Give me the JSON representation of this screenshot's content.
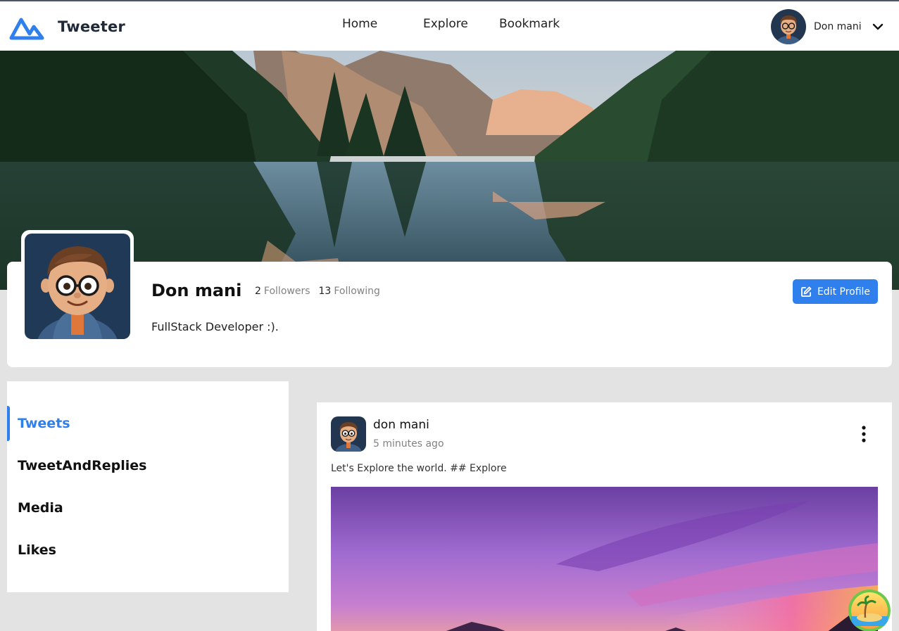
{
  "app": {
    "brand_name": "Tweeter",
    "brand_icon": "mountain-logo-icon",
    "accent_color": "#2f80ed"
  },
  "nav": {
    "links": [
      "Home",
      "Explore",
      "Bookmark"
    ]
  },
  "user_menu": {
    "name": "Don mani",
    "avatar_icon": "cartoon-avatar",
    "dropdown_icon": "chevron-down-icon"
  },
  "profile": {
    "name": "Don mani",
    "followers_count": "2",
    "followers_label": "Followers",
    "following_count": "13",
    "following_label": "Following",
    "bio": "FullStack Developer :).",
    "edit_button_label": "Edit Profile",
    "edit_icon": "edit-icon"
  },
  "tabs": {
    "items": [
      "Tweets",
      "TweetAndReplies",
      "Media",
      "Likes"
    ],
    "active": "Tweets"
  },
  "tweet": {
    "author": "don mani",
    "time": "5 minutes ago",
    "text": "Let's Explore the world. ## Explore",
    "menu_icon": "more-vertical-icon"
  }
}
